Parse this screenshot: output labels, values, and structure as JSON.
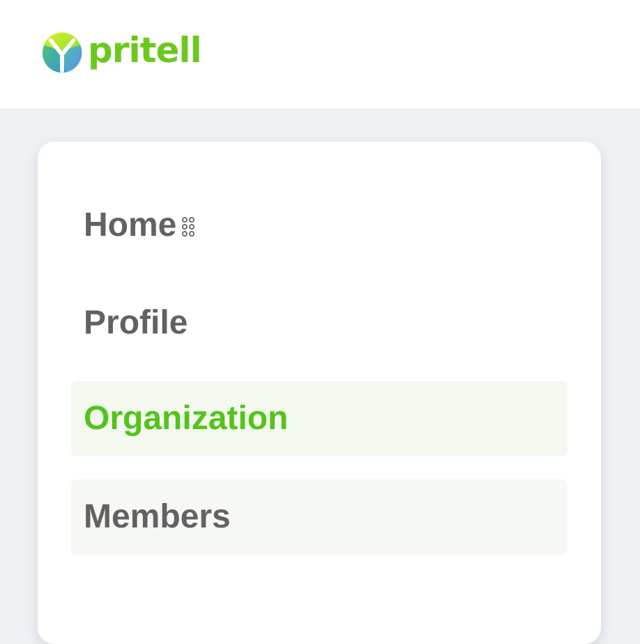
{
  "brand": {
    "name": "pritell",
    "color": "#6cc81f",
    "logo_icon": "pritell-logo-icon"
  },
  "nav": {
    "items": [
      {
        "label": "Home",
        "icon": "drag-handle-icon",
        "state": "default"
      },
      {
        "label": "Profile",
        "state": "default"
      },
      {
        "label": "Organization",
        "state": "active"
      },
      {
        "label": "Members",
        "state": "highlighted"
      }
    ]
  },
  "colors": {
    "active_text": "#52c41a",
    "default_text": "#626262",
    "page_background": "#eef1f4",
    "panel_background": "#ffffff",
    "active_item_background": "#f4f9f0"
  }
}
